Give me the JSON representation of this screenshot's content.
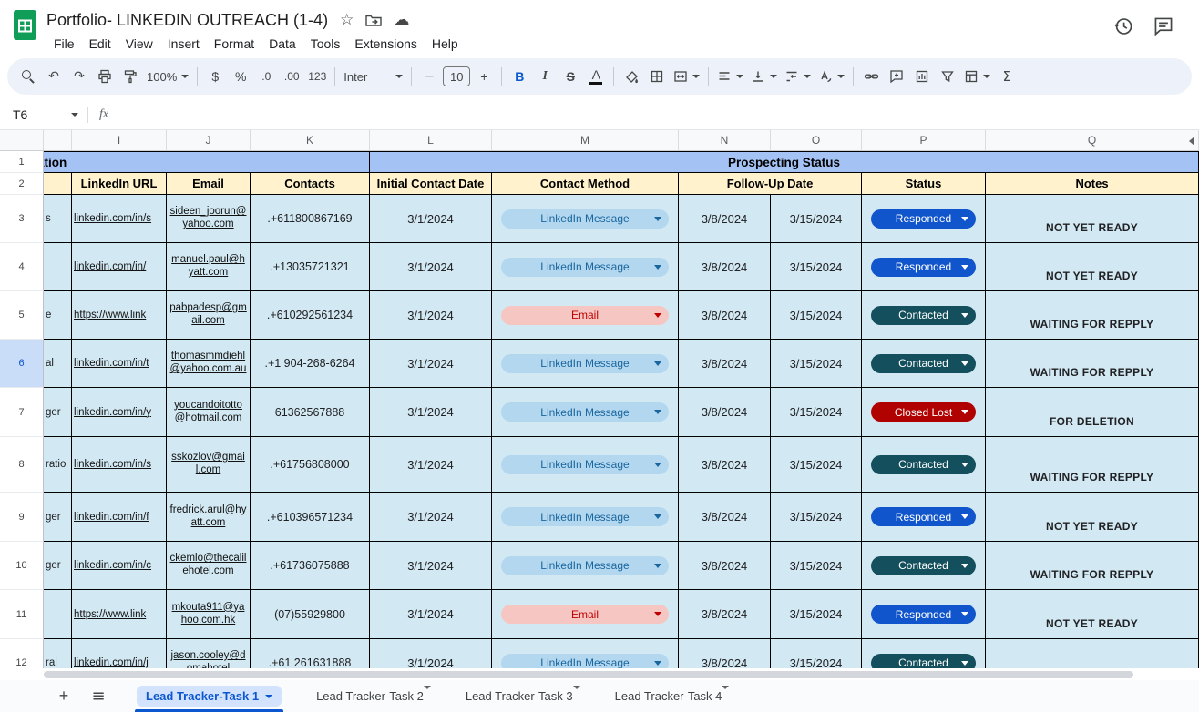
{
  "colors": {
    "header_band_bg": "#a4c2f4",
    "subheader_bg": "#fff2cc",
    "cell_bg": "#d2e8f2",
    "linkedin_pill_bg": "#b3d7ef",
    "linkedin_pill_text": "#19669e",
    "email_pill_bg": "#f6c7c2",
    "email_pill_text": "#c00000",
    "responded_bg": "#1155cc",
    "contacted_bg": "#134f5c",
    "closed_lost_bg": "#b10202",
    "active_tab_text": "#0b57d0",
    "active_tab_bg": "#d3e3fd",
    "selected_rowhead_bg": "#c9ddf8",
    "table_border": "#000000"
  },
  "topbar": {
    "title": "Portfolio- LINKEDIN OUTREACH (1-4)",
    "menus": [
      "File",
      "Edit",
      "View",
      "Insert",
      "Format",
      "Data",
      "Tools",
      "Extensions",
      "Help"
    ],
    "star_icon": "☆",
    "cloud_icon": "☁"
  },
  "toolbar": {
    "undo_icon": "↶",
    "redo_icon": "↷",
    "zoom": "100%",
    "currency": "$",
    "percent": "%",
    "decrease_decimals": ".0",
    "increase_decimals": ".00",
    "more_formats": "123",
    "font": "Inter",
    "decrease_font": "−",
    "font_size": "10",
    "increase_font": "+",
    "bold": "B",
    "italic": "I",
    "strikethrough": "S",
    "text_color": "A",
    "functions": "Σ"
  },
  "formula_bar": {
    "cell_reference": "T6",
    "fx_label": "fx"
  },
  "grid": {
    "column_letters": [
      "I",
      "J",
      "K",
      "L",
      "M",
      "N",
      "O",
      "P",
      "Q"
    ],
    "selected_row": "6",
    "row1": {
      "num": "1",
      "left_fragment": "ation",
      "right_title": "Prospecting Status"
    },
    "row2": {
      "num": "2",
      "linkedin_url": "LinkedIn URL",
      "email": "Email",
      "contacts": "Contacts",
      "initial_contact_date": "Initial Contact Date",
      "contact_method": "Contact Method",
      "follow_up_date": "Follow-Up Date",
      "status": "Status",
      "notes": "Notes"
    },
    "rows": [
      {
        "num": "3",
        "fragment": "s",
        "url": "linkedin.com/in/s",
        "email": "sideen_joorun@yahoo.com",
        "contacts": ".+611800867169",
        "initial_contact_date": "3/1/2024",
        "contact_method": "LinkedIn Message",
        "method_type": "linkedin",
        "follow_up_1": "3/8/2024",
        "follow_up_2": "3/15/2024",
        "status": "Responded",
        "status_type": "responded",
        "notes": "NOT YET READY"
      },
      {
        "num": "4",
        "fragment": "",
        "url": "linkedin.com/in/",
        "email": "manuel.paul@hyatt.com",
        "contacts": ".+13035721321",
        "initial_contact_date": "3/1/2024",
        "contact_method": "LinkedIn Message",
        "method_type": "linkedin",
        "follow_up_1": "3/8/2024",
        "follow_up_2": "3/15/2024",
        "status": "Responded",
        "status_type": "responded",
        "notes": "NOT YET READY"
      },
      {
        "num": "5",
        "fragment": "e",
        "url": "https://www.link",
        "email": "pabpadesp@gmail.com",
        "contacts": ".+610292561234",
        "initial_contact_date": "3/1/2024",
        "contact_method": "Email",
        "method_type": "email",
        "follow_up_1": "3/8/2024",
        "follow_up_2": "3/15/2024",
        "status": "Contacted",
        "status_type": "contacted",
        "notes": "WAITING FOR REPPLY"
      },
      {
        "num": "6",
        "fragment": "al",
        "url": "linkedin.com/in/t",
        "email": "thomasmmdiehl@yahoo.com.au",
        "contacts": ".+1 904-268-6264",
        "initial_contact_date": "3/1/2024",
        "contact_method": "LinkedIn Message",
        "method_type": "linkedin",
        "follow_up_1": "3/8/2024",
        "follow_up_2": "3/15/2024",
        "status": "Contacted",
        "status_type": "contacted",
        "notes": "WAITING FOR REPPLY"
      },
      {
        "num": "7",
        "fragment": "ger",
        "url": "linkedin.com/in/y",
        "email": "youcandoitotto@hotmail.com",
        "contacts": "61362567888",
        "initial_contact_date": "3/1/2024",
        "contact_method": "LinkedIn Message",
        "method_type": "linkedin",
        "follow_up_1": "3/8/2024",
        "follow_up_2": "3/15/2024",
        "status": "Closed Lost",
        "status_type": "closed_lost",
        "notes": "FOR DELETION"
      },
      {
        "num": "8",
        "fragment": "ratio",
        "url": "linkedin.com/in/s",
        "email": "sskozlov@gmail.com",
        "contacts": ".+61756808000",
        "initial_contact_date": "3/1/2024",
        "contact_method": "LinkedIn Message",
        "method_type": "linkedin",
        "follow_up_1": "3/8/2024",
        "follow_up_2": "3/15/2024",
        "status": "Contacted",
        "status_type": "contacted",
        "notes": "WAITING FOR REPPLY"
      },
      {
        "num": "9",
        "fragment": "ger",
        "url": "linkedin.com/in/f",
        "email": "fredrick.arul@hyatt.com",
        "contacts": ".+610396571234",
        "initial_contact_date": "3/1/2024",
        "contact_method": "LinkedIn Message",
        "method_type": "linkedin",
        "follow_up_1": "3/8/2024",
        "follow_up_2": "3/15/2024",
        "status": "Responded",
        "status_type": "responded",
        "notes": "NOT YET READY"
      },
      {
        "num": "10",
        "fragment": "ger",
        "url": "linkedin.com/in/c",
        "email": "ckemlo@thecalilehotel.com",
        "contacts": ".+61736075888",
        "initial_contact_date": "3/1/2024",
        "contact_method": "LinkedIn Message",
        "method_type": "linkedin",
        "follow_up_1": "3/8/2024",
        "follow_up_2": "3/15/2024",
        "status": "Contacted",
        "status_type": "contacted",
        "notes": "WAITING FOR REPPLY"
      },
      {
        "num": "11",
        "fragment": "",
        "url": "https://www.link",
        "email": "mkouta911@yahoo.com.hk",
        "contacts": "(07)55929800",
        "initial_contact_date": "3/1/2024",
        "contact_method": "Email",
        "method_type": "email",
        "follow_up_1": "3/8/2024",
        "follow_up_2": "3/15/2024",
        "status": "Responded",
        "status_type": "responded",
        "notes": "NOT YET READY"
      },
      {
        "num": "12",
        "fragment": "ral",
        "url": "linkedin.com/in/j",
        "email": "jason.cooley@domahotel",
        "contacts": ".+61 261631888",
        "initial_contact_date": "3/1/2024",
        "contact_method": "LinkedIn Message",
        "method_type": "linkedin",
        "follow_up_1": "3/8/2024",
        "follow_up_2": "3/15/2024",
        "status": "Contacted",
        "status_type": "contacted",
        "notes": ""
      }
    ]
  },
  "tabbar": {
    "add_icon": "+",
    "all_sheets_icon": "≡",
    "tabs": [
      {
        "label": "Lead Tracker-Task 1",
        "active": true
      },
      {
        "label": "Lead Tracker-Task 2",
        "active": false
      },
      {
        "label": "Lead Tracker-Task 3",
        "active": false
      },
      {
        "label": "Lead Tracker-Task 4",
        "active": false
      }
    ]
  }
}
